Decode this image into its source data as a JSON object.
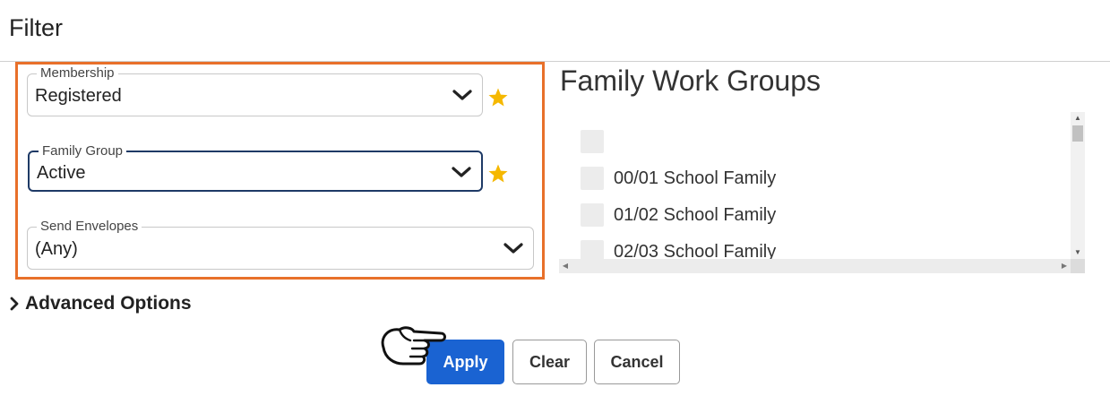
{
  "page": {
    "title": "Filter"
  },
  "filters": {
    "membership": {
      "label": "Membership",
      "value": "Registered"
    },
    "family_group": {
      "label": "Family Group",
      "value": "Active"
    },
    "send_envelopes": {
      "label": "Send Envelopes",
      "value": "(Any)"
    }
  },
  "work_groups": {
    "title": "Family Work Groups",
    "items": [
      {
        "label": ""
      },
      {
        "label": "00/01 School Family"
      },
      {
        "label": "01/02 School Family"
      },
      {
        "label": "02/03 School Family"
      }
    ]
  },
  "advanced": {
    "label": "Advanced Options"
  },
  "buttons": {
    "apply": "Apply",
    "clear": "Clear",
    "cancel": "Cancel"
  },
  "colors": {
    "highlight": "#e8702a",
    "primary": "#1a63d2",
    "active_border": "#1e3a66",
    "star": "#f5b800"
  },
  "icons": [
    "chevron-down-icon",
    "star-icon",
    "chevron-right-icon",
    "pointing-hand-icon"
  ]
}
